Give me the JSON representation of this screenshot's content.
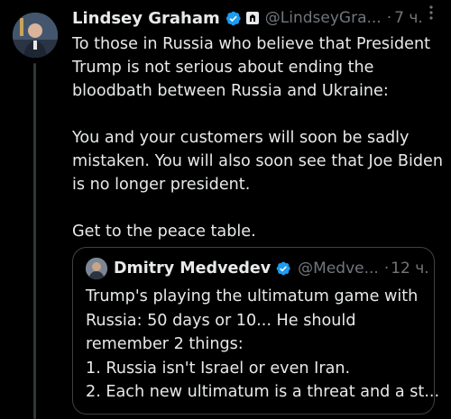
{
  "tweet": {
    "author": {
      "name": "Lindsey Graham",
      "handle": "@LindseyGra...",
      "time": "7 ч.",
      "dot": "·"
    },
    "paragraphs": [
      [
        "To those in Russia who believe that President",
        "Trump is not serious about ending the",
        "bloodbath between Russia and Ukraine:"
      ],
      [
        "You and your customers will soon be sadly",
        "mistaken. You will also soon see that Joe Biden",
        "is no longer president."
      ],
      [
        "Get to the peace table."
      ]
    ]
  },
  "quoted": {
    "author": {
      "name": "Dmitry Medvedev",
      "handle": "@Medve...",
      "time": "12 ч.",
      "dot": "·"
    },
    "lines": [
      "Trump's playing the ultimatum game with",
      "Russia: 50 days or 10... He should",
      "remember 2 things:",
      "1. Russia isn't Israel or even Iran.",
      "2. Each new ultimatum is a threat and a st..."
    ]
  },
  "colors": {
    "background": "#000000",
    "text": "#e7e9ea",
    "secondary": "#71767b",
    "verified": "#1d9bf0",
    "border": "#3e4144"
  },
  "icons": {
    "verified": "verified-badge-icon",
    "affiliation": "government-affiliation-icon",
    "more": "more-options-icon"
  }
}
